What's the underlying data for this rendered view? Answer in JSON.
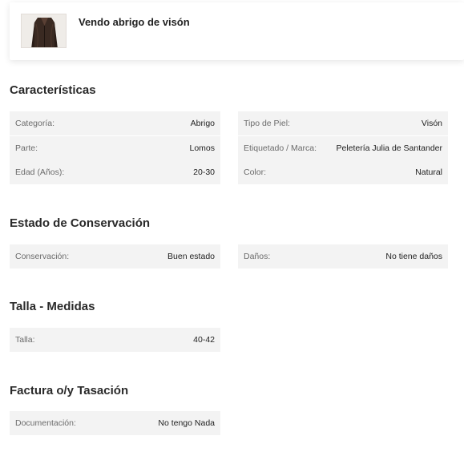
{
  "header": {
    "title": "Vendo abrigo de visón",
    "thumbnail_icon": "coat-photo"
  },
  "sections": {
    "caracteristicas": {
      "title": "Características",
      "left": [
        {
          "label": "Categoría:",
          "value": "Abrigo"
        },
        {
          "label": "Parte:",
          "value": "Lomos"
        },
        {
          "label": "Edad (Años):",
          "value": "20-30"
        }
      ],
      "right": [
        {
          "label": "Tipo de Piel:",
          "value": "Visón"
        },
        {
          "label": "Etiquetado / Marca:",
          "value": "Peletería Julia de Santander"
        },
        {
          "label": "Color:",
          "value": "Natural"
        }
      ]
    },
    "conservacion": {
      "title": "Estado de Conservación",
      "left": [
        {
          "label": "Conservación:",
          "value": "Buen estado"
        }
      ],
      "right": [
        {
          "label": "Daños:",
          "value": "No tiene daños"
        }
      ]
    },
    "talla": {
      "title": "Talla - Medidas",
      "left": [
        {
          "label": "Talla:",
          "value": "40-42"
        }
      ]
    },
    "factura": {
      "title": "Factura o/y Tasación",
      "left": [
        {
          "label": "Documentación:",
          "value": "No tengo Nada"
        }
      ]
    }
  }
}
